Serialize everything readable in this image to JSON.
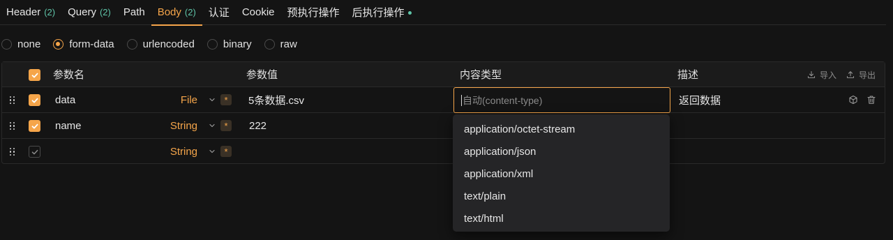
{
  "tabs": [
    {
      "label": "Header",
      "count": "(2)"
    },
    {
      "label": "Query",
      "count": "(2)"
    },
    {
      "label": "Path",
      "count": ""
    },
    {
      "label": "Body",
      "count": "(2)",
      "active": true
    },
    {
      "label": "认证",
      "count": ""
    },
    {
      "label": "Cookie",
      "count": ""
    },
    {
      "label": "预执行操作",
      "count": ""
    },
    {
      "label": "后执行操作",
      "count": "",
      "dot": true
    }
  ],
  "body_types": [
    {
      "label": "none",
      "checked": false
    },
    {
      "label": "form-data",
      "checked": true
    },
    {
      "label": "urlencoded",
      "checked": false
    },
    {
      "label": "binary",
      "checked": false
    },
    {
      "label": "raw",
      "checked": false
    }
  ],
  "table": {
    "headers": {
      "name": "参数名",
      "value": "参数值",
      "content_type": "内容类型",
      "description": "描述"
    },
    "import_label": "导入",
    "export_label": "导出",
    "rows": [
      {
        "name": "data",
        "type": "File",
        "value": "5条数据.csv",
        "description": "返回数据",
        "checked": true
      },
      {
        "name": "name",
        "type": "String",
        "value": "222",
        "description": "",
        "checked": true
      },
      {
        "name": "",
        "type": "String",
        "value": "",
        "description": "",
        "checked": false
      }
    ],
    "required_mark": "*"
  },
  "content_type_input": {
    "placeholder": "自动(content-type)"
  },
  "content_type_options": [
    "application/octet-stream",
    "application/json",
    "application/xml",
    "text/plain",
    "text/html"
  ],
  "colors": {
    "accent": "#f5a54a",
    "count": "#5fc4a8",
    "background": "#141414"
  },
  "icons": {
    "row_handle": "drag-handle-icon",
    "import": "download-icon",
    "export": "upload-icon",
    "row_actions": [
      "cube-icon",
      "trash-icon"
    ]
  }
}
